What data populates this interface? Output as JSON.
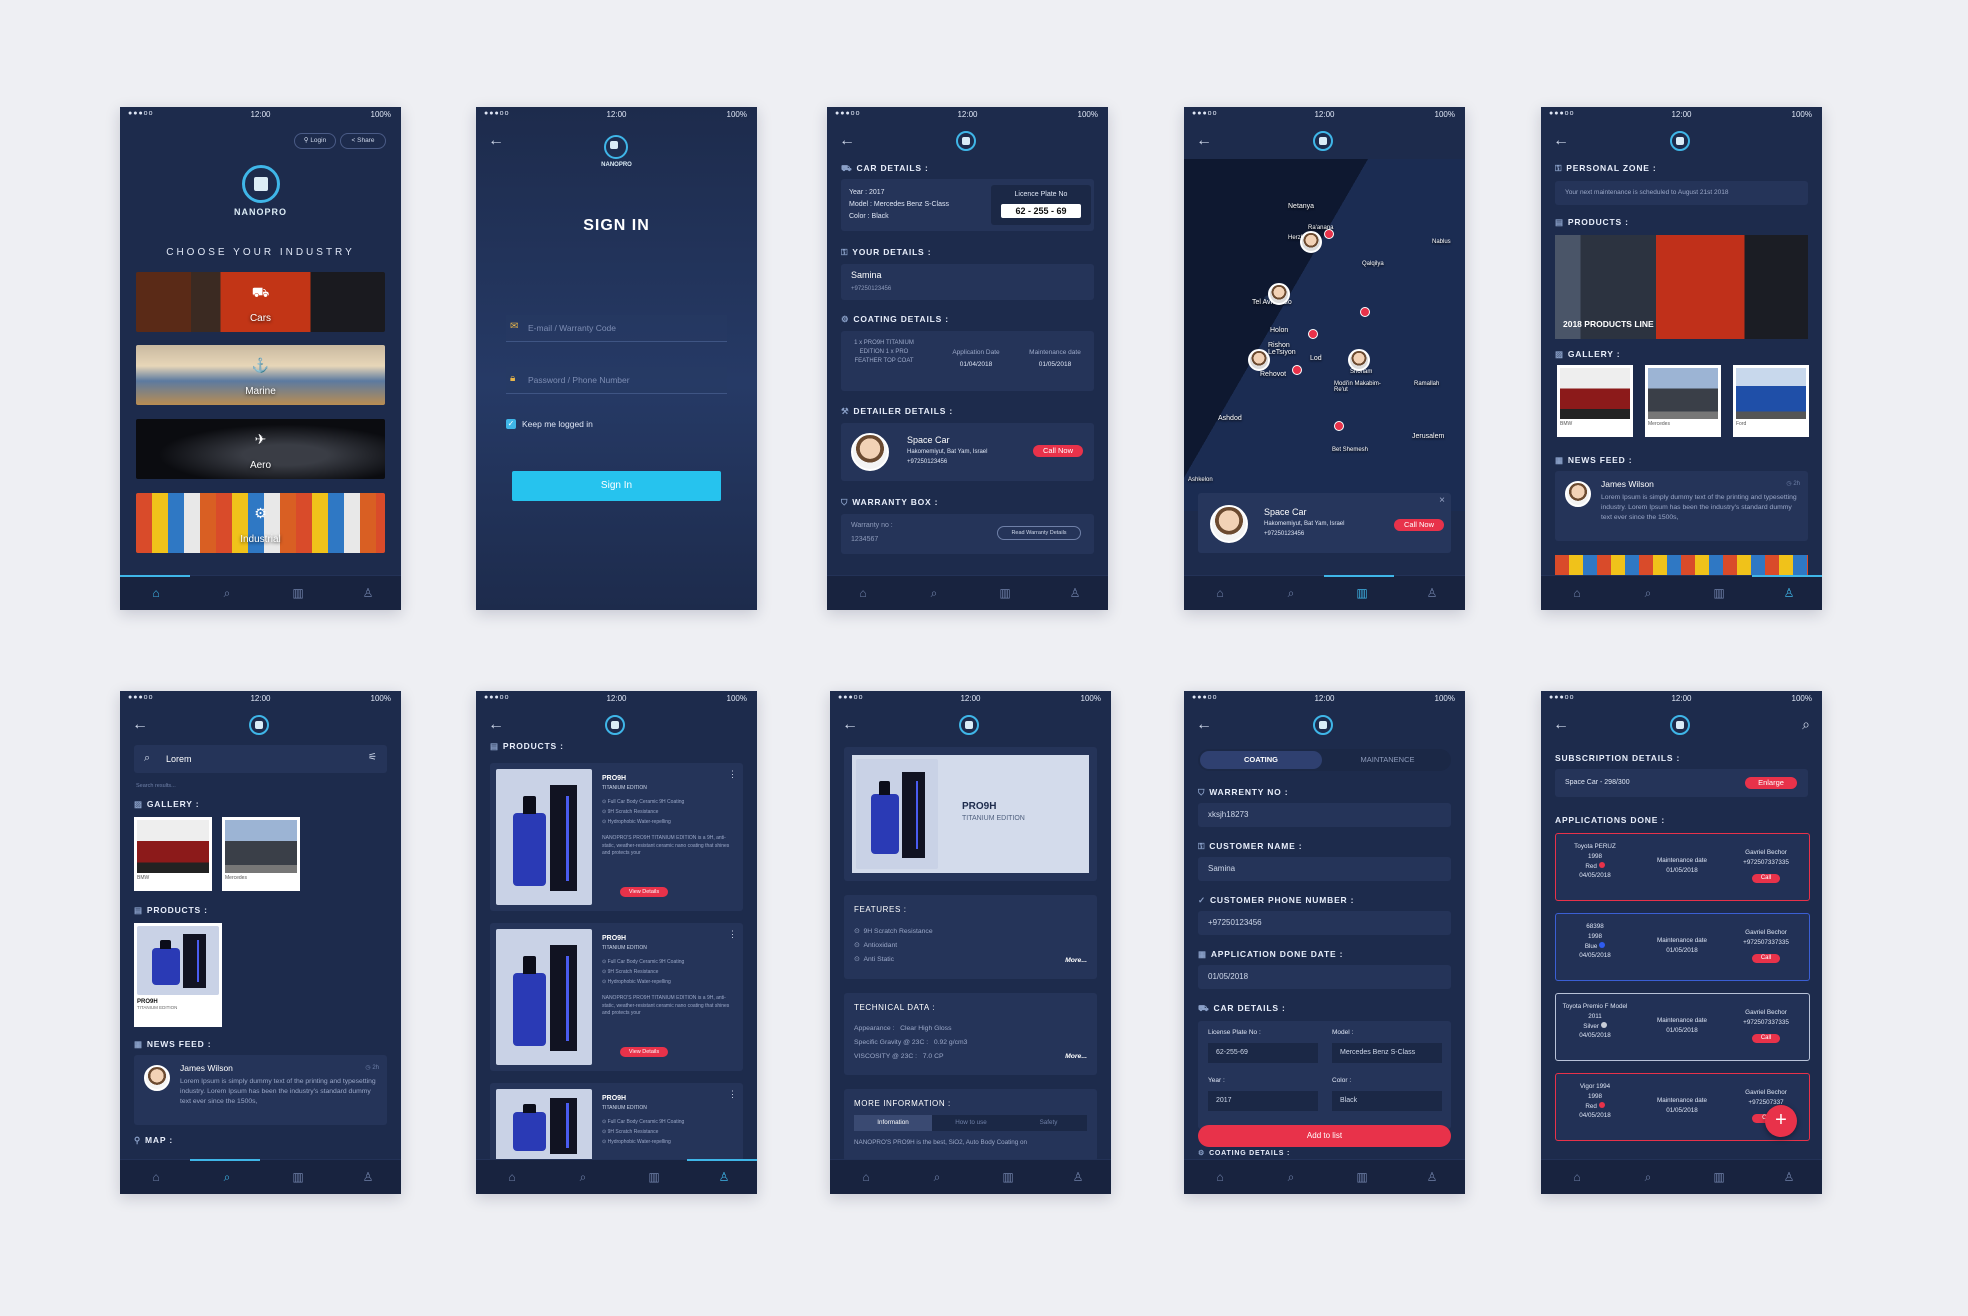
{
  "status": {
    "carrier": "●●●oo",
    "time": "12:00",
    "battery": "100%"
  },
  "tabs": {
    "home": "⌂",
    "search": "⌕",
    "shop": "▥",
    "profile": "♙"
  },
  "s1": {
    "login": "⚲ Login",
    "share": "< Share",
    "brand": "NANOPRO",
    "title": "CHOOSE YOUR INDUSTRY",
    "industries": [
      "Cars",
      "Marine",
      "Aero",
      "Industrial"
    ]
  },
  "s2": {
    "brand": "NANOPRO",
    "title": "SIGN IN",
    "email_placeholder": "E-mail / Warranty Code",
    "password_placeholder": "Password / Phone Number",
    "keep": "Keep me logged in",
    "button": "Sign In"
  },
  "s3": {
    "car_details": "CAR DETAILS :",
    "year": "Year : 2017",
    "model": "Model : Mercedes Benz S-Class",
    "color": "Color : Black",
    "plate_label": "Licence Plate No",
    "plate": "62 - 255 - 69",
    "your_details": "YOUR DETAILS :",
    "name": "Samina",
    "phone": "+97250123456",
    "coating": "COATING DETAILS :",
    "coat_items": "1 x PRO9H TITANIUM EDITION 1 x PRO FEATHER TOP COAT",
    "app_date_label": "Application Date",
    "app_date": "01/04/2018",
    "maint_label": "Maintenance date",
    "maint": "01/05/2018",
    "detailer": "DETAILER DETAILS :",
    "detailer_name": "Space Car",
    "detailer_addr": "Hakomemiyut, Bat Yam, Israel",
    "detailer_phone": "+97250123456",
    "call": "Call Now",
    "warranty": "WARRANTY BOX :",
    "warranty_no_label": "Warranty no :",
    "warranty_no": "1234567",
    "read_warranty": "Read Warranty Details"
  },
  "s4": {
    "labels": [
      "Netanya",
      "Tel Aviv-Yafo",
      "Holon",
      "Rishon LeTsiyon",
      "Rehovot",
      "Ashdod",
      "Lod",
      "Shoham",
      "Modi'in Makabim-Re'ut",
      "Jerusalem",
      "Bet Shemesh",
      "Herzliya",
      "Ra'anana",
      "Ashkelon",
      "Nablus",
      "Qalqilya",
      "Ramallah"
    ],
    "popup_name": "Space Car",
    "popup_addr": "Hakomemiyut, Bat Yam, Israel",
    "popup_phone": "+97250123456",
    "call": "Call Now",
    "close": "×"
  },
  "s5": {
    "personal": "PERSONAL ZONE :",
    "maintenance_note": "Your next maintenance is scheduled to August 21st 2018",
    "products": "PRODUCTS :",
    "banner": "2018 PRODUCTS LINE",
    "gallery": "GALLERY :",
    "gallery_items": [
      "BMW",
      "Mercedes",
      "Ford"
    ],
    "news": "NEWS FEED :",
    "feed_name": "James Wilson",
    "feed_time": "◷ 2h",
    "feed_text": "Lorem Ipsum is simply dummy text of the printing and typesetting industry. Lorem Ipsum has been the industry's standard dummy text ever since the 1500s,"
  },
  "s6": {
    "search_value": "Lorem",
    "search_results": "Search results...",
    "gallery": "GALLERY :",
    "gallery_items": [
      "BMW",
      "Mercedes"
    ],
    "products": "PRODUCTS :",
    "product_name": "PRO9H",
    "product_sub": "TITANIUM EDITION",
    "news": "NEWS FEED :",
    "feed_name": "James Wilson",
    "feed_time": "◷ 2h",
    "feed_text": "Lorem Ipsum is simply dummy text of the printing and typesetting industry. Lorem Ipsum has been the industry's standard dummy text ever since the 1500s,",
    "map": "MAP :"
  },
  "s7": {
    "products": "PRODUCTS :",
    "items": [
      {
        "name": "PRO9H",
        "sub": "TITANIUM EDITION",
        "f1": "Full Car Body Ceramic 9H Coating",
        "f2": "9H Scratch Resistance",
        "f3": "Hydrophobic Water-repelling",
        "desc": "NANOPRO'S PRO9H TITANIUM EDITION is a 9H, anti-static, weather-resistant ceramic nano coating that shines and protects your",
        "btn": "View Details"
      },
      {
        "name": "PRO9H",
        "sub": "TITANIUM EDITION",
        "f1": "Full Car Body Ceramic 9H Coating",
        "f2": "9H Scratch Resistance",
        "f3": "Hydrophobic Water-repelling",
        "desc": "NANOPRO'S PRO9H TITANIUM EDITION is a 9H, anti-static, weather-resistant ceramic nano coating that shines and protects your",
        "btn": "View Details"
      },
      {
        "name": "PRO9H",
        "sub": "TITANIUM EDITION",
        "f1": "Full Car Body Ceramic 9H Coating",
        "f2": "9H Scratch Resistance",
        "f3": "Hydrophobic Water-repelling",
        "desc": "",
        "btn": ""
      }
    ]
  },
  "s8": {
    "product_name": "PRO9H",
    "product_sub": "TITANIUM EDITION",
    "features": "FEATURES :",
    "f1": "9H Scratch Resistance",
    "f2": "Antioxidant",
    "f3": "Anti Static",
    "more": "More...",
    "technical": "TECHNICAL DATA :",
    "appearance_label": "Appearance :",
    "appearance": "Clear High Gloss",
    "gravity_label": "Specific Gravity @ 23C :",
    "gravity": "0.92 g/cm3",
    "viscosity_label": "VISCOSITY @ 23C :",
    "viscosity": "7.0 CP",
    "more_info": "MORE INFORMATION :",
    "info_tabs": [
      "Information",
      "How to use",
      "Safety"
    ],
    "info_text": "NANOPRO'S PRO9H is the best, SiO2, Auto Body Coating on"
  },
  "s9": {
    "tab1": "COATING",
    "tab2": "MAINTANENCE",
    "warranty": "WARRENTY NO :",
    "warranty_val": "xksjh18273",
    "customer": "CUSTOMER NAME :",
    "customer_val": "Samina",
    "phone": "CUSTOMER PHONE NUMBER :",
    "phone_val": "+97250123456",
    "date": "APPLICATION DONE DATE :",
    "date_val": "01/05/2018",
    "car": "CAR DETAILS :",
    "plate_label": "License Plate No :",
    "plate_val": "62-255-69",
    "model_label": "Model :",
    "model_val": "Mercedes Benz S-Class",
    "year_label": "Year :",
    "year_val": "2017",
    "color_label": "Color :",
    "color_val": "Black",
    "add": "Add to list",
    "coating_more": "COATING DETAILS :"
  },
  "s10": {
    "subscription": "SUBSCRIPTION DETAILS :",
    "plan": "Space Car - 298/300",
    "enlarge": "Enlarge",
    "applications": "APPLICATIONS DONE :",
    "apps": [
      {
        "car": "Toyota PERUZ",
        "year": "1998",
        "color": "Red",
        "date": "04/05/2018",
        "maint_label": "Maintenance date",
        "maint": "01/05/2018",
        "who": "Gavriel Bechor",
        "phone": "+972507337335",
        "call": "Call"
      },
      {
        "car": "68398",
        "year": "1998",
        "color": "Blue",
        "date": "04/05/2018",
        "maint_label": "Maintenance date",
        "maint": "01/05/2018",
        "who": "Gavriel Bechor",
        "phone": "+972507337335",
        "call": "Call"
      },
      {
        "car": "Toyota Premio F Model",
        "year": "2011",
        "color": "Silver",
        "date": "04/05/2018",
        "maint_label": "Maintenance date",
        "maint": "01/05/2018",
        "who": "Gavriel Bechor",
        "phone": "+972507337335",
        "call": "Call"
      },
      {
        "car": "Vigor 1994",
        "year": "1998",
        "color": "Red",
        "date": "04/05/2018",
        "maint_label": "Maintenance date",
        "maint": "01/05/2018",
        "who": "Gavriel Bechor",
        "phone": "+972507337",
        "call": "Ca"
      }
    ],
    "fab": "+"
  }
}
